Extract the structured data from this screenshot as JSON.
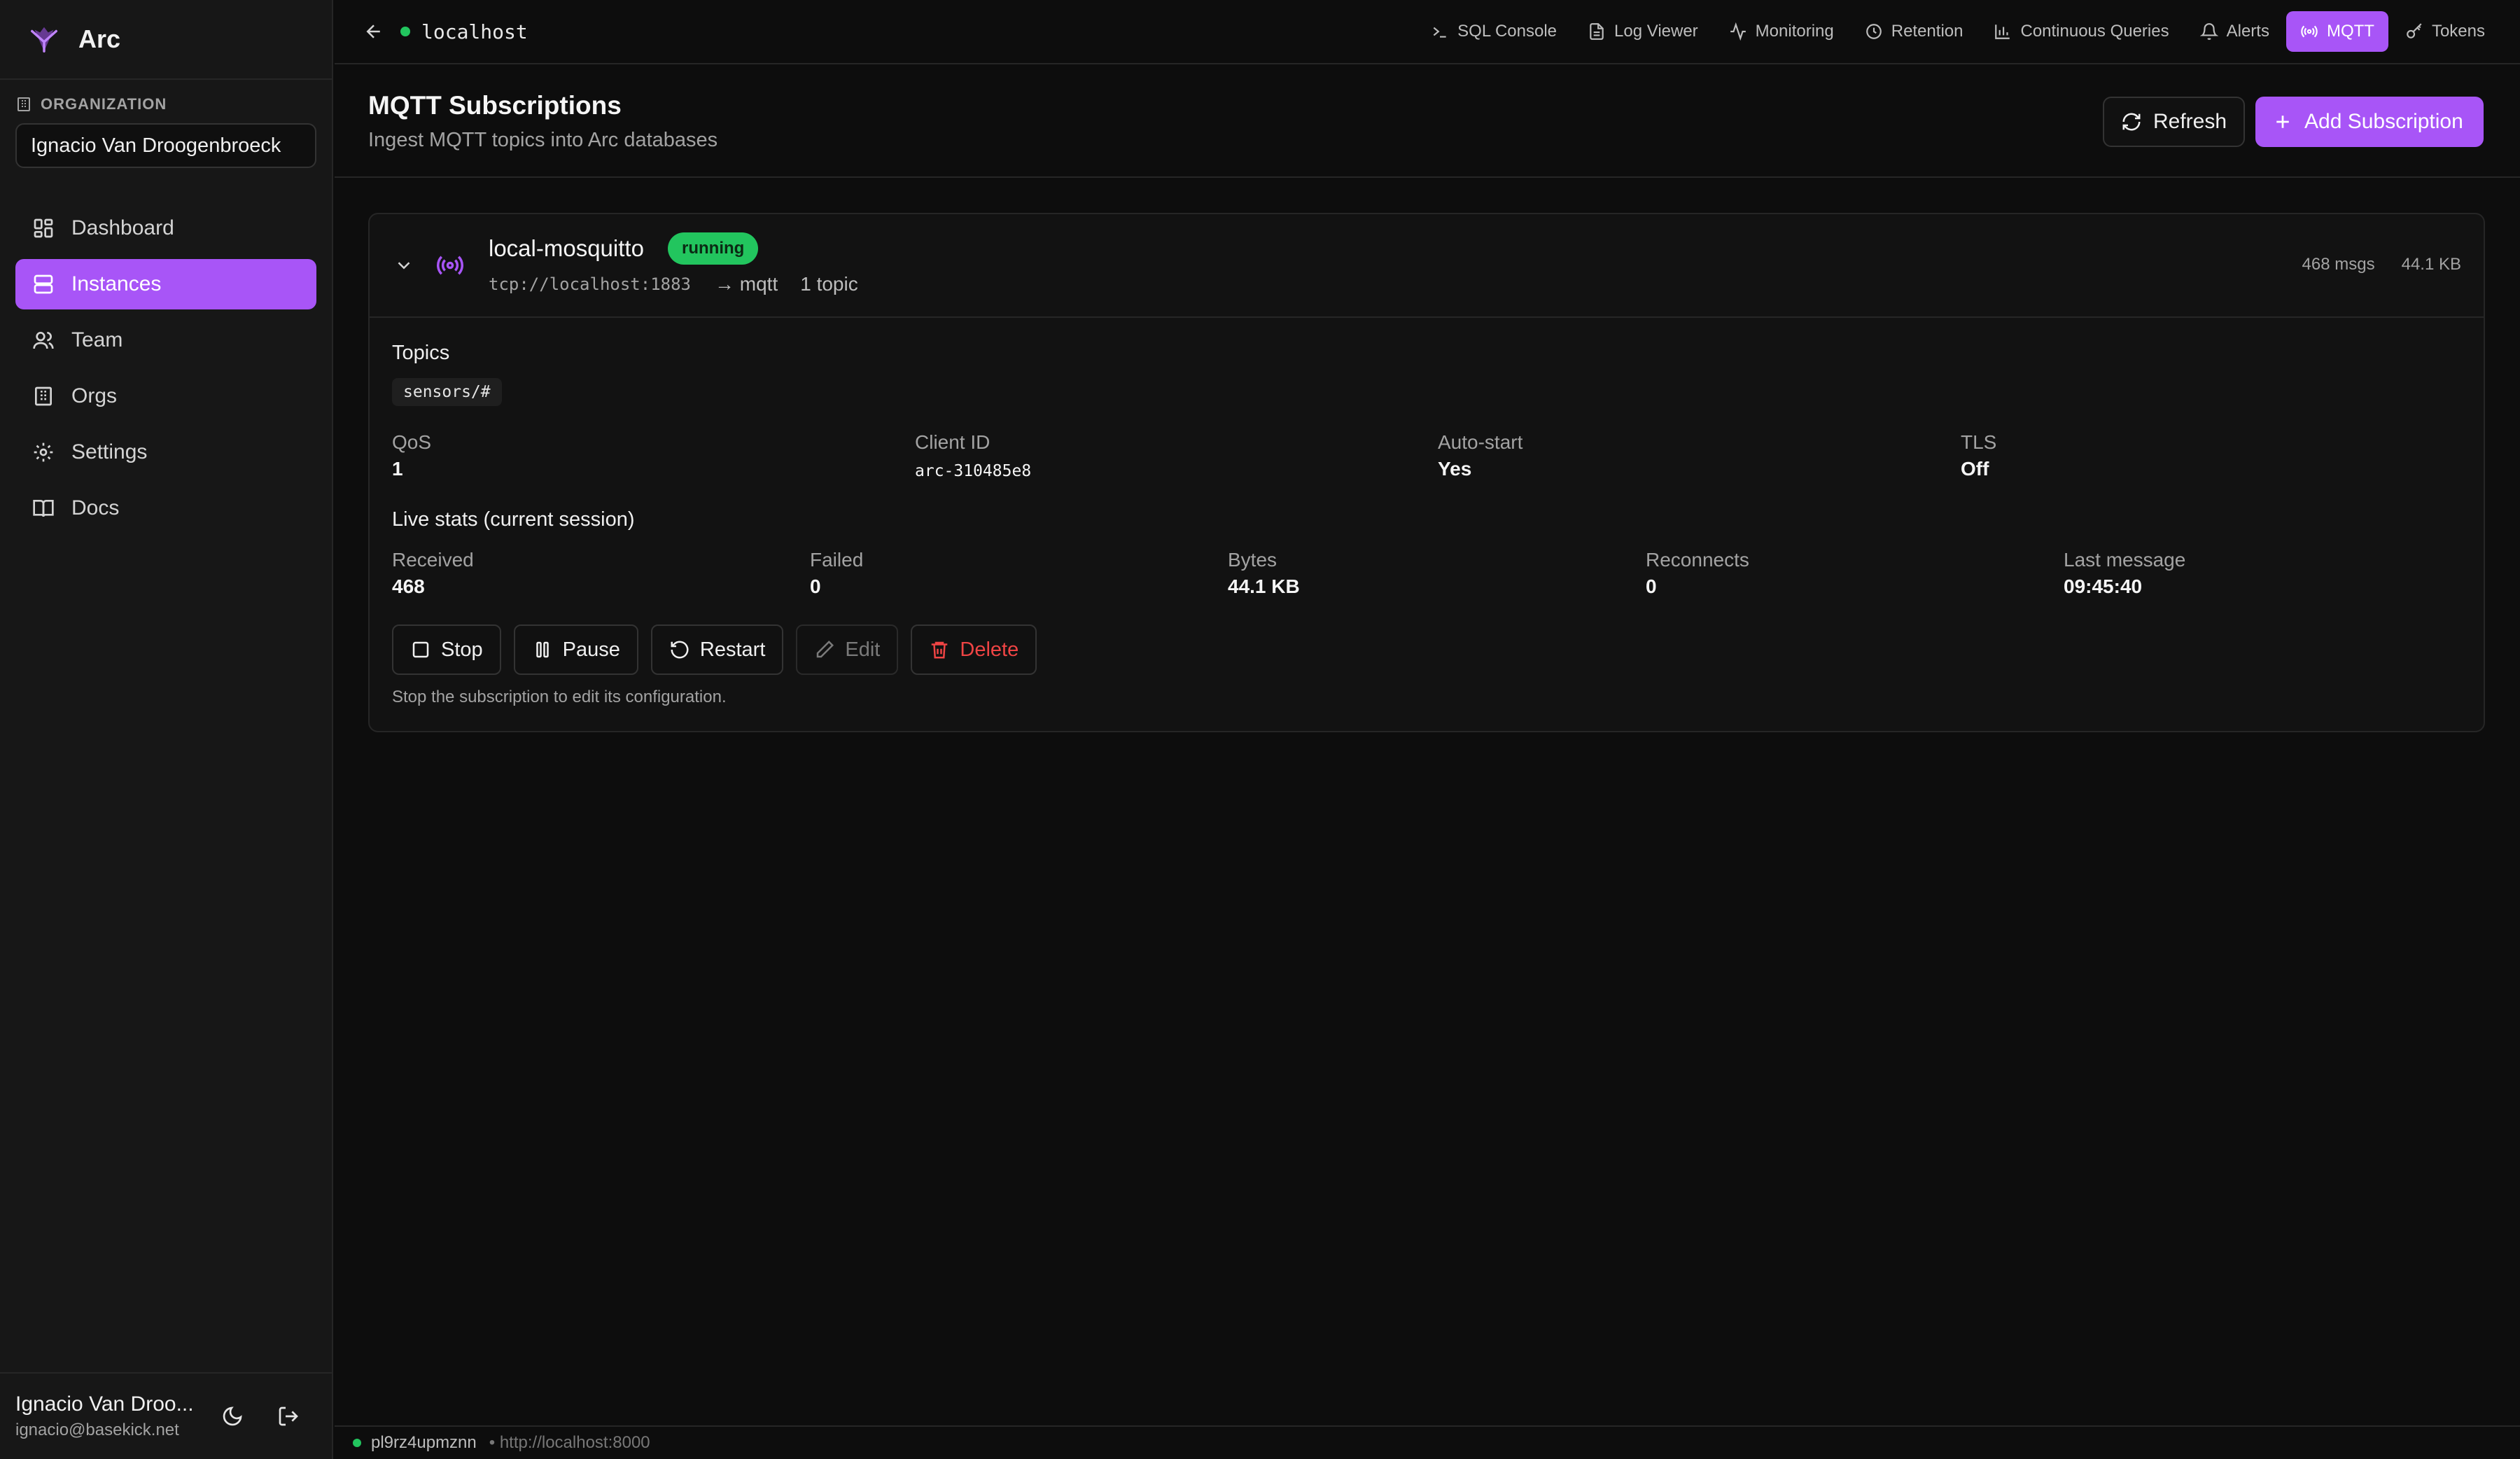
{
  "app": {
    "name": "Arc"
  },
  "sidebar": {
    "org_label": "ORGANIZATION",
    "org_value": "Ignacio Van Droogenbroeck",
    "items": [
      {
        "label": "Dashboard",
        "icon": "dashboard-icon"
      },
      {
        "label": "Instances",
        "icon": "server-icon",
        "active": true
      },
      {
        "label": "Team",
        "icon": "users-icon"
      },
      {
        "label": "Orgs",
        "icon": "building-icon"
      },
      {
        "label": "Settings",
        "icon": "gear-icon"
      },
      {
        "label": "Docs",
        "icon": "book-icon"
      }
    ],
    "user": {
      "name": "Ignacio Van Droo...",
      "email": "ignacio@basekick.net"
    }
  },
  "topbar": {
    "host": "localhost",
    "nav": [
      {
        "label": "SQL Console",
        "icon": "terminal-icon"
      },
      {
        "label": "Log Viewer",
        "icon": "file-icon"
      },
      {
        "label": "Monitoring",
        "icon": "activity-icon"
      },
      {
        "label": "Retention",
        "icon": "clock-icon"
      },
      {
        "label": "Continuous Queries",
        "icon": "bar-chart-icon"
      },
      {
        "label": "Alerts",
        "icon": "bell-icon"
      },
      {
        "label": "MQTT",
        "icon": "radio-icon",
        "active": true
      },
      {
        "label": "Tokens",
        "icon": "key-icon"
      }
    ]
  },
  "header": {
    "title": "MQTT Subscriptions",
    "subtitle": "Ingest MQTT topics into Arc databases",
    "refresh_label": "Refresh",
    "add_label": "Add Subscription"
  },
  "subscription": {
    "name": "local-mosquitto",
    "status": "running",
    "url": "tcp://localhost:1883",
    "target": "→ mqtt",
    "topic_count": "1 topic",
    "msgs": "468 msgs",
    "bytes": "44.1 KB",
    "topics_label": "Topics",
    "topics": [
      "sensors/#"
    ],
    "config": [
      {
        "label": "QoS",
        "value": "1"
      },
      {
        "label": "Client ID",
        "value": "arc-310485e8"
      },
      {
        "label": "Auto-start",
        "value": "Yes"
      },
      {
        "label": "TLS",
        "value": "Off"
      }
    ],
    "live_label": "Live stats (current session)",
    "live": [
      {
        "label": "Received",
        "value": "468"
      },
      {
        "label": "Failed",
        "value": "0"
      },
      {
        "label": "Bytes",
        "value": "44.1 KB"
      },
      {
        "label": "Reconnects",
        "value": "0"
      },
      {
        "label": "Last message",
        "value": "09:45:40"
      }
    ],
    "actions": {
      "stop": "Stop",
      "pause": "Pause",
      "restart": "Restart",
      "edit": "Edit",
      "delete": "Delete"
    },
    "hint": "Stop the subscription to edit its configuration."
  },
  "statusbar": {
    "id": "pl9rz4upmznn",
    "url": "• http://localhost:8000"
  },
  "colors": {
    "accent": "#a855f7",
    "success": "#22c55e",
    "danger": "#ef4444"
  }
}
